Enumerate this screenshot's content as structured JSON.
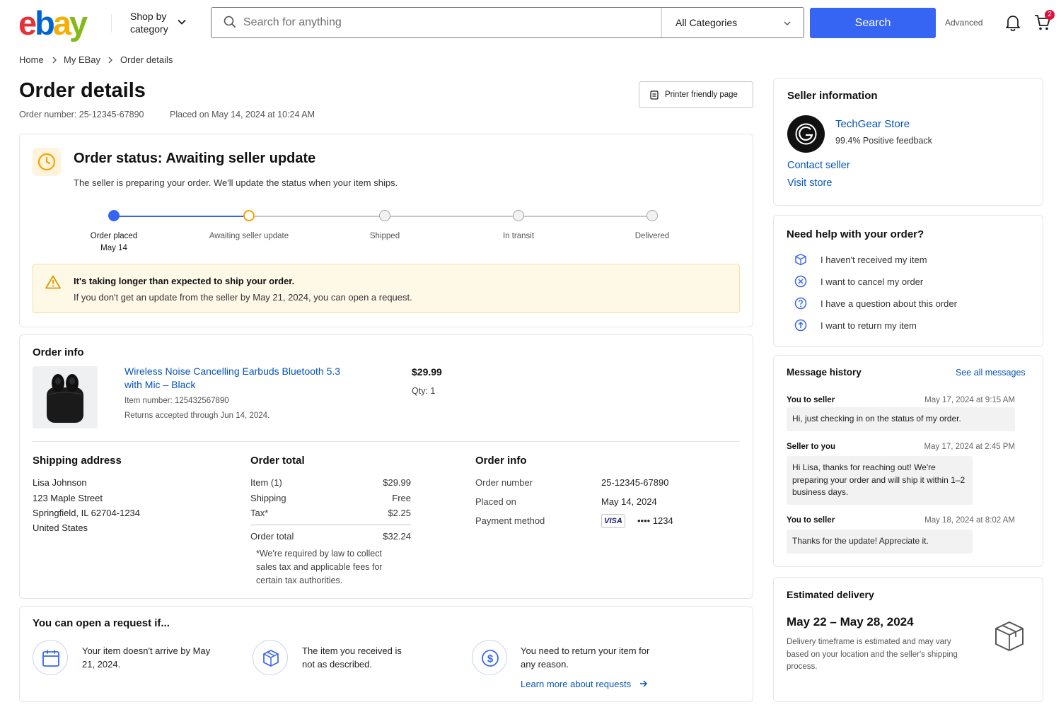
{
  "header": {
    "logo": {
      "e": "e",
      "b": "b",
      "a": "a",
      "y": "y"
    },
    "shop_by_category": "Shop by category",
    "search_placeholder": "Search for anything",
    "category": "All Categories",
    "search_button": "Search",
    "advanced": "Advanced",
    "cart_count": "2"
  },
  "breadcrumb": [
    "Home",
    "My EBay",
    "Order details"
  ],
  "page": {
    "title": "Order details",
    "order_number": "Order number: 25-12345-67890",
    "placed_on": "Placed on May 14, 2024 at 10:24 AM",
    "print_button": "Printer friendly page"
  },
  "status": {
    "title": "Order status: Awaiting seller update",
    "description": "The seller is preparing your order. We'll update the status when your item ships.",
    "steps": [
      {
        "label": "Order placed",
        "sub": "May 14",
        "state": "complete"
      },
      {
        "label": "Awaiting seller update",
        "sub": "",
        "state": "current"
      },
      {
        "label": "Shipped",
        "sub": "",
        "state": "pending"
      },
      {
        "label": "In transit",
        "sub": "",
        "state": "pending"
      },
      {
        "label": "Delivered",
        "sub": "",
        "state": "pending"
      }
    ],
    "warning_title": "It's taking longer than expected to ship your order.",
    "warning_text": "If you don't get an update from the seller by May 21, 2024, you can open a request."
  },
  "order_info": {
    "title": "Order info",
    "item_title": "Wireless Noise Cancelling Earbuds Bluetooth 5.3 with Mic – Black",
    "item_number": "Item number: 125432567890",
    "returns": "Returns accepted through Jun 14, 2024.",
    "price": "$29.99",
    "qty": "Qty: 1"
  },
  "shipping": {
    "title": "Shipping address",
    "lines": [
      "Lisa Johnson",
      "123 Maple Street",
      "Springfield, IL 62704-1234",
      "United States"
    ]
  },
  "totals": {
    "title": "Order total",
    "rows": [
      {
        "label": "Item (1)",
        "value": "$29.99"
      },
      {
        "label": "Shipping",
        "value": "Free"
      },
      {
        "label": "Tax*",
        "value": "$2.25"
      }
    ],
    "total_label": "Order total",
    "total_value": "$32.24",
    "tax_note": "*We're required by law to collect sales tax and applicable fees for certain tax authorities."
  },
  "order_meta": {
    "title": "Order info",
    "order_number_label": "Order number",
    "order_number": "25-12345-67890",
    "placed_label": "Placed on",
    "placed": "May 14, 2024",
    "payment_label": "Payment method",
    "card_brand": "VISA",
    "card_last4": "•••• 1234"
  },
  "requests": {
    "title": "You can open a request if...",
    "items": [
      "Your item doesn't arrive by May 21, 2024.",
      "The item you received is not as described.",
      "You need to return your item for any reason."
    ],
    "learn_more": "Learn more about requests"
  },
  "seller": {
    "title": "Seller information",
    "name": "TechGear Store",
    "feedback": "99.4% Positive feedback",
    "contact": "Contact seller",
    "visit": "Visit store"
  },
  "help": {
    "title": "Need help with your order?",
    "items": [
      "I haven't received my item",
      "I want to cancel my order",
      "I have a question about this order",
      "I want to return my item"
    ]
  },
  "messages": {
    "title": "Message history",
    "see_all": "See all messages",
    "items": [
      {
        "from": "You to seller",
        "time": "May 17, 2024 at 9:15 AM",
        "text": "Hi, just checking in on the status of my order."
      },
      {
        "from": "Seller to you",
        "time": "May 17, 2024 at 2:45 PM",
        "text": "Hi Lisa, thanks for reaching out! We're preparing your order and will ship it within 1–2 business days."
      },
      {
        "from": "You to seller",
        "time": "May 18, 2024 at 8:02 AM",
        "text": "Thanks for the update! Appreciate it."
      }
    ]
  },
  "delivery": {
    "title": "Estimated delivery",
    "dates": "May 22 – May 28, 2024",
    "note": "Delivery timeframe is estimated and may vary based on your location and the seller's shipping process."
  },
  "colors": {
    "accent": "#3665f3",
    "link": "#0654ba",
    "warning_bg": "#fef8e7",
    "status_orange": "#f5a300"
  }
}
